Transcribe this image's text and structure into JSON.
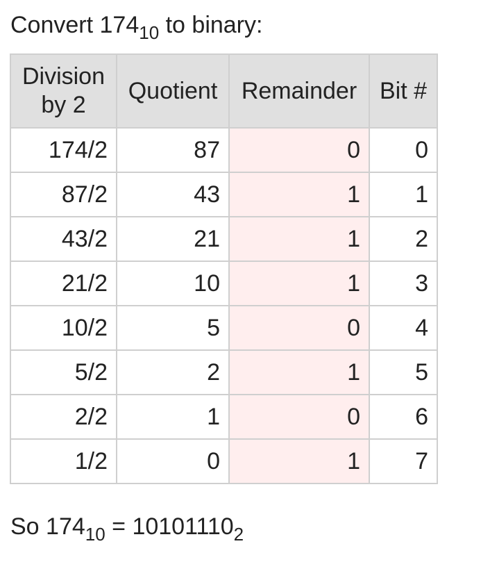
{
  "heading": {
    "prefix": "Convert 174",
    "base": "10",
    "suffix": " to binary:"
  },
  "table": {
    "headers": {
      "division_line1": "Division",
      "division_line2": "by 2",
      "quotient": "Quotient",
      "remainder": "Remainder",
      "bit": "Bit #"
    },
    "rows": [
      {
        "division": "174/2",
        "quotient": "87",
        "remainder": "0",
        "bit": "0"
      },
      {
        "division": "87/2",
        "quotient": "43",
        "remainder": "1",
        "bit": "1"
      },
      {
        "division": "43/2",
        "quotient": "21",
        "remainder": "1",
        "bit": "2"
      },
      {
        "division": "21/2",
        "quotient": "10",
        "remainder": "1",
        "bit": "3"
      },
      {
        "division": "10/2",
        "quotient": "5",
        "remainder": "0",
        "bit": "4"
      },
      {
        "division": "5/2",
        "quotient": "2",
        "remainder": "1",
        "bit": "5"
      },
      {
        "division": "2/2",
        "quotient": "1",
        "remainder": "0",
        "bit": "6"
      },
      {
        "division": "1/2",
        "quotient": "0",
        "remainder": "1",
        "bit": "7"
      }
    ]
  },
  "result": {
    "prefix": "So 174",
    "base_from": "10",
    "equals": " = ",
    "binary": "10101110",
    "base_to": "2"
  },
  "colors": {
    "header_bg": "#e0e0e0",
    "remainder_bg": "#ffeeee",
    "border": "#cfcfcf",
    "text": "#222222"
  }
}
